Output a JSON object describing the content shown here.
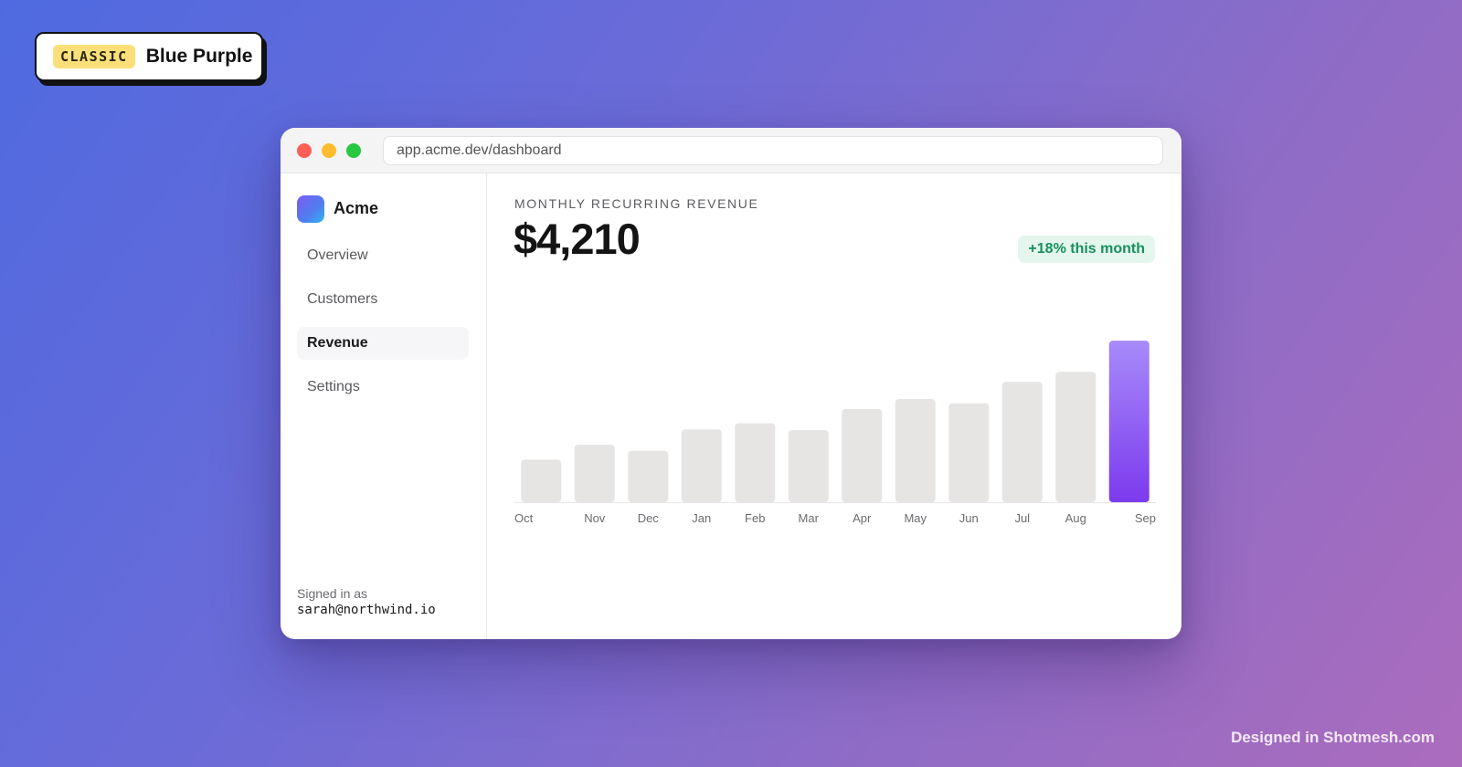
{
  "badge": {
    "tag": "CLASSIC",
    "name": "Blue Purple"
  },
  "browser": {
    "url": "app.acme.dev/dashboard"
  },
  "sidebar": {
    "brand": "Acme",
    "items": [
      {
        "label": "Overview",
        "active": false
      },
      {
        "label": "Customers",
        "active": false
      },
      {
        "label": "Revenue",
        "active": true
      },
      {
        "label": "Settings",
        "active": false
      }
    ],
    "signed_in_label": "Signed in as",
    "signed_in_email": "sarah@northwind.io"
  },
  "main": {
    "metric_label": "MONTHLY RECURRING REVENUE",
    "metric_value": "$4,210",
    "growth_badge": "+18% this month"
  },
  "footer": {
    "credit": "Designed in Shotmesh.com"
  },
  "colors": {
    "bar_default": "#e6e5e4",
    "bar_highlight_top": "#a78bfa",
    "bar_highlight_bottom": "#7c3aed",
    "growth_text": "#17905f",
    "growth_bg": "#e4f6ee"
  },
  "chart_data": {
    "type": "bar",
    "categories": [
      "Oct",
      "Nov",
      "Dec",
      "Jan",
      "Feb",
      "Mar",
      "Apr",
      "May",
      "Jun",
      "Jul",
      "Aug",
      "Sep"
    ],
    "values": [
      1110,
      1500,
      1340,
      1900,
      2060,
      1880,
      2430,
      2690,
      2580,
      3140,
      3400,
      4210
    ],
    "highlight_index": 11,
    "ylim": [
      0,
      5000
    ],
    "grid": false,
    "title": "",
    "xlabel": "",
    "ylabel": ""
  }
}
